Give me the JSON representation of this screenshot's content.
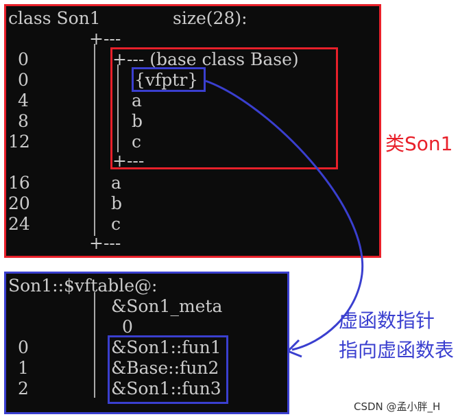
{
  "colors": {
    "console_bg": "#0c0c0c",
    "console_text": "#cccccc",
    "red_box": "#e8202a",
    "blue_box": "#3a3fcf",
    "red_label": "#e8202a",
    "blue_label": "#3a3fcf"
  },
  "layout_dump": {
    "header_left": "class Son1",
    "header_right": "size(28):",
    "rule": "+---",
    "base_header": "+--- (base class Base)",
    "base_rows": [
      {
        "offset": "0",
        "name": "{vfptr}"
      },
      {
        "offset": "4",
        "name": "a"
      },
      {
        "offset": "8",
        "name": "b"
      },
      {
        "offset": "12",
        "name": "c"
      }
    ],
    "base_rule": "+---",
    "base_offset": "0",
    "rows": [
      {
        "offset": "16",
        "name": "a"
      },
      {
        "offset": "20",
        "name": "b"
      },
      {
        "offset": "24",
        "name": "c"
      }
    ],
    "end_rule": "+---"
  },
  "vftable": {
    "header": "Son1::$vftable@:",
    "meta": "&Son1_meta",
    "meta_offset": "0",
    "entries": [
      {
        "index": "0",
        "name": "&Son1::fun1"
      },
      {
        "index": "1",
        "name": "&Base::fun2"
      },
      {
        "index": "2",
        "name": "&Son1::fun3"
      }
    ]
  },
  "annotations": {
    "class_label": "类Son1",
    "pointer_label_line1": "虚函数指针",
    "pointer_label_line2": "指向虚函数表"
  },
  "watermark": "CSDN @孟小胖_H"
}
